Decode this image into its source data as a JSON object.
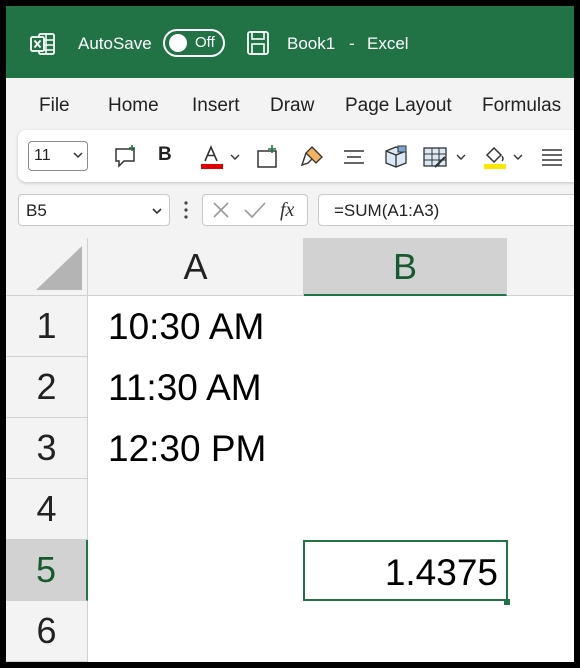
{
  "titlebar": {
    "autosave_label": "AutoSave",
    "autosave_state": "Off",
    "document_name": "Book1",
    "separator": "-",
    "app_name": "Excel",
    "color": "#217346"
  },
  "tabs": [
    "File",
    "Home",
    "Insert",
    "Draw",
    "Page Layout",
    "Formulas"
  ],
  "ribbon": {
    "font_size": "11",
    "bold_label": "B",
    "font_color": "#e00000",
    "highlight_color": "#ffe600",
    "icons": [
      "comment-icon",
      "bold-icon",
      "font-color-icon",
      "insert-icon",
      "format-painter-icon",
      "align-icon",
      "cube-icon",
      "table-format-icon",
      "fill-color-icon",
      "menu-lines-icon"
    ]
  },
  "formula_bar": {
    "name_box": "B5",
    "formula": "=SUM(A1:A3)"
  },
  "sheet": {
    "columns": [
      "A",
      "B"
    ],
    "rows": [
      "1",
      "2",
      "3",
      "4",
      "5",
      "6"
    ],
    "cells": {
      "A1": "10:30 AM",
      "A2": "11:30 AM",
      "A3": "12:30 PM",
      "B5": "1.4375"
    },
    "active_cell": "B5"
  }
}
